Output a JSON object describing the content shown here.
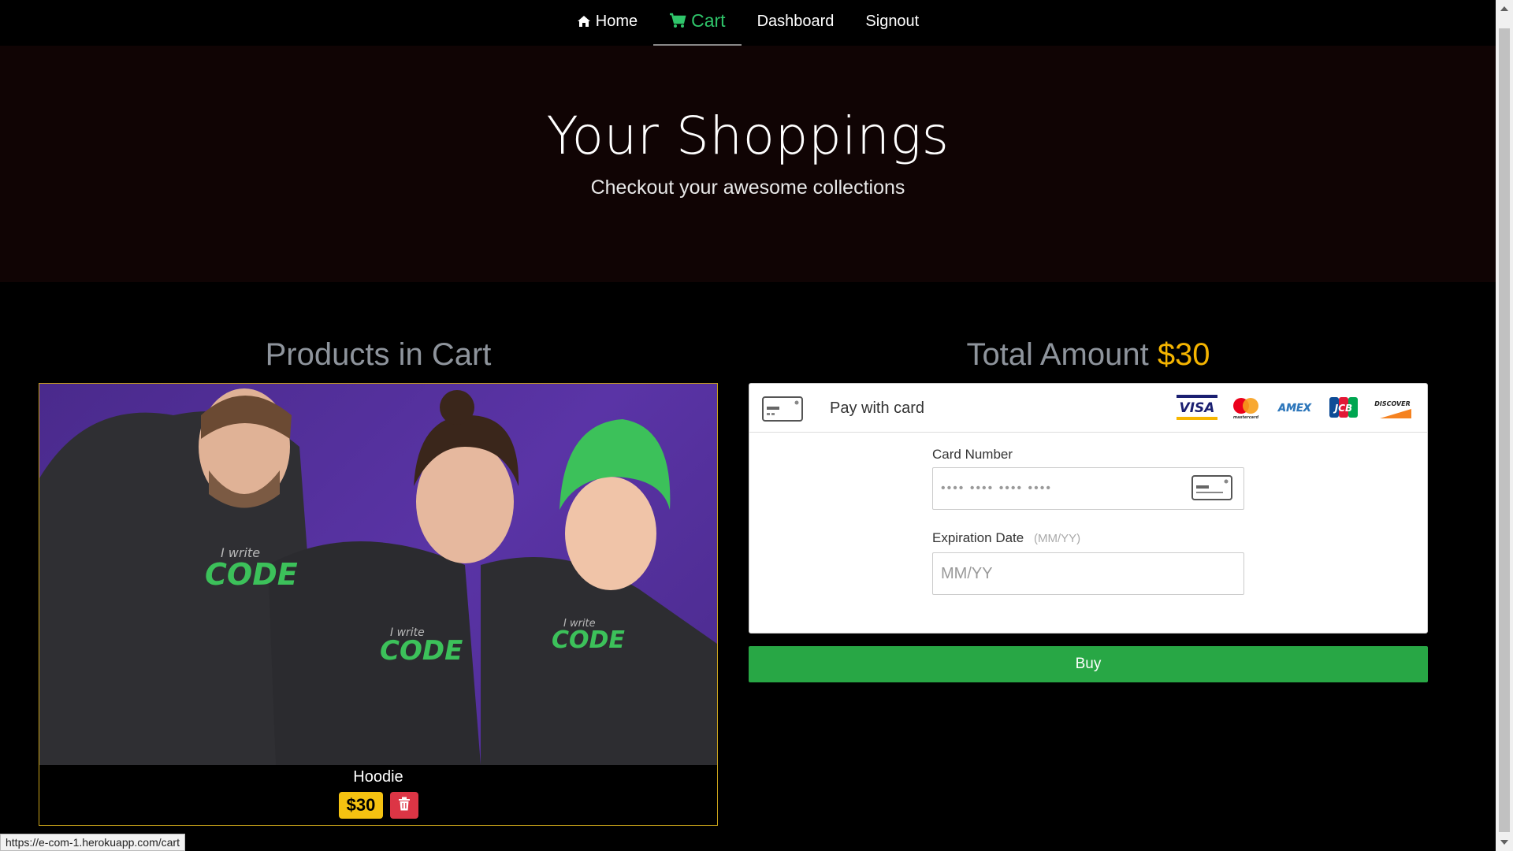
{
  "nav": {
    "items": [
      {
        "label": "Home",
        "icon": "home-icon"
      },
      {
        "label": "Cart",
        "icon": "cart-icon",
        "active": true
      },
      {
        "label": "Dashboard"
      },
      {
        "label": "Signout"
      }
    ]
  },
  "hero": {
    "title": "Your Shoppings",
    "subtitle": "Checkout your awesome collections"
  },
  "cart": {
    "heading": "Products in Cart",
    "product": {
      "name": "Hoodie",
      "price": "$30",
      "image_text_small": "I write",
      "image_text_big": "CODE"
    }
  },
  "payment": {
    "heading_label": "Total Amount",
    "total": "$30",
    "title": "Pay with card",
    "brands": [
      "VISA",
      "mastercard",
      "AMEX",
      "JCB",
      "DISCOVER"
    ],
    "card_number_label": "Card Number",
    "card_number_placeholder": "•••• •••• •••• ••••",
    "expiry_label": "Expiration Date",
    "expiry_hint": "(MM/YY)",
    "expiry_placeholder": "MM/YY",
    "buy_label": "Buy"
  },
  "status_bar": {
    "url": "https://e-com-1.herokuapp.com/cart"
  },
  "colors": {
    "accent_green": "#28a745",
    "nav_active": "#2fc56a",
    "amount_yellow": "#f4b400",
    "delete_red": "#dc3545"
  }
}
